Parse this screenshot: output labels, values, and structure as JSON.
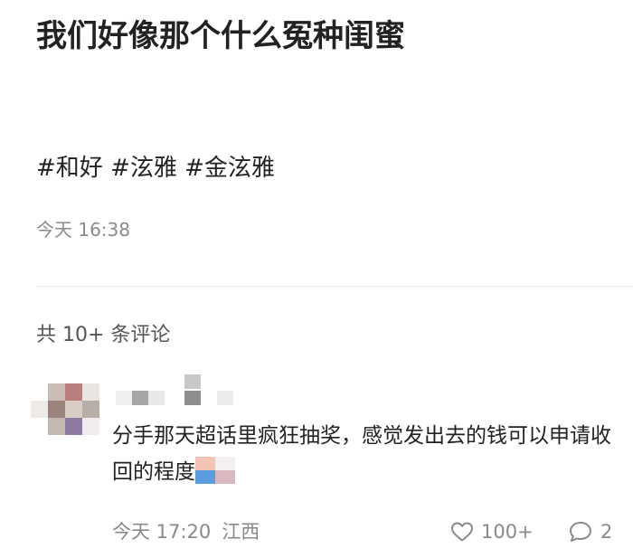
{
  "post": {
    "title": "我们好像那个什么冤种闺蜜",
    "hashtags": [
      "#和好",
      "#泫雅",
      "#金泫雅"
    ],
    "time": "今天 16:38"
  },
  "comments_section": {
    "count_label": "共 10+ 条评论"
  },
  "comment": {
    "text": "分手那天超话里疯狂抽奖，感觉发出去的钱可以申请收回的程度",
    "time": "今天 17:20",
    "location": "江西",
    "likes": "100+",
    "replies": "2"
  },
  "colors": {
    "text_primary": "#222222",
    "text_secondary": "#8a8a8a",
    "divider": "#e6e6e6"
  },
  "icons": {
    "like": "heart-outline-icon",
    "reply": "speech-bubble-icon"
  }
}
